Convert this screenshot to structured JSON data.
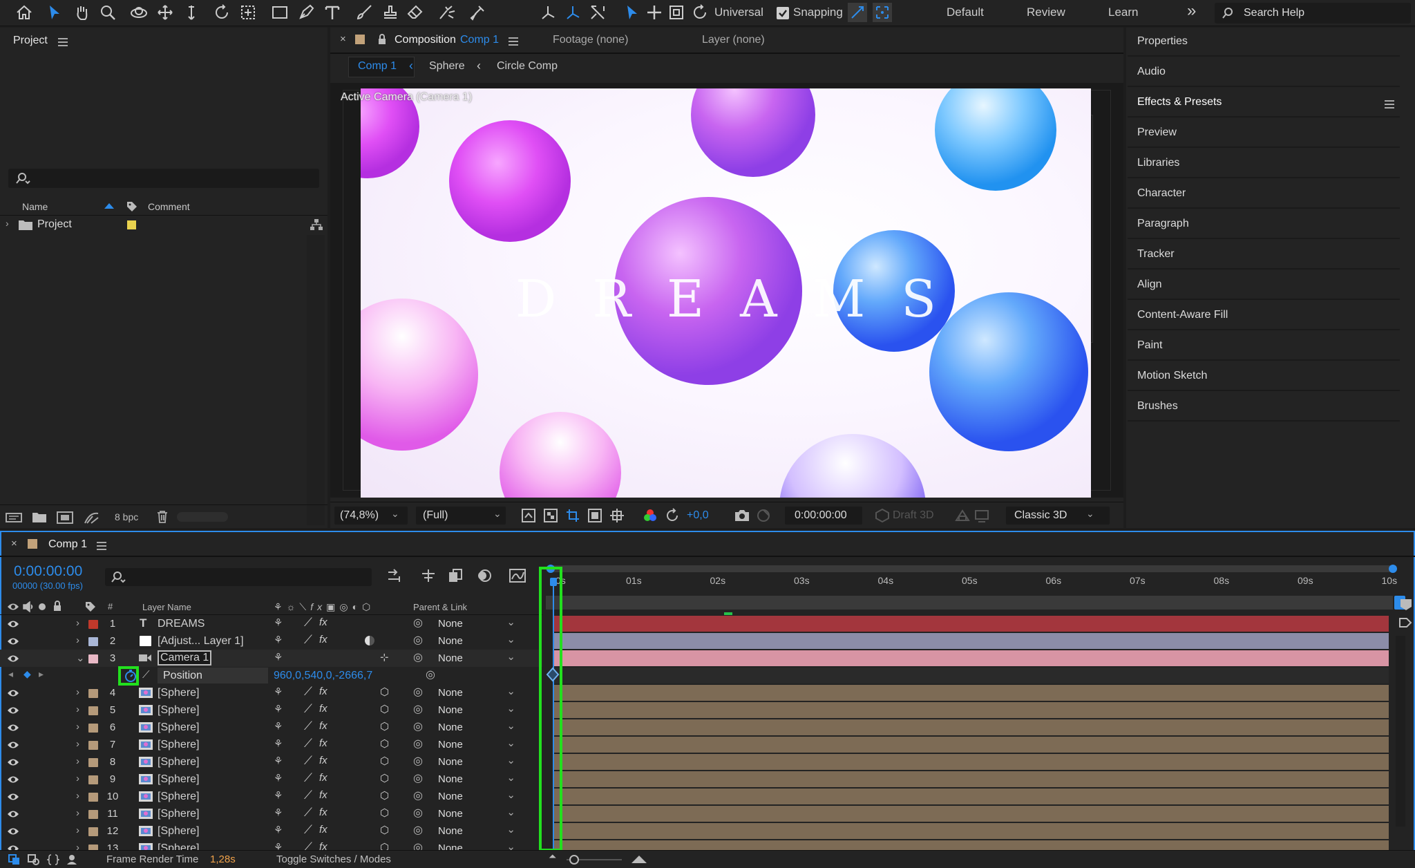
{
  "toolbar": {
    "universal": "Universal",
    "snapping": "Snapping",
    "workspaces": [
      "Default",
      "Review",
      "Learn"
    ],
    "more": "»",
    "search_placeholder": "Search Help"
  },
  "project": {
    "title": "Project",
    "col_name": "Name",
    "col_comment": "Comment",
    "item": "Project",
    "bpc": "8 bpc"
  },
  "comp": {
    "tab_title": "Composition",
    "tab_comp": "Comp 1",
    "footage": "Footage (none)",
    "layer": "Layer (none)",
    "breadcrumbs": [
      "Comp 1",
      "Sphere",
      "Circle Comp"
    ],
    "camera_label": "Active Camera (Camera 1)",
    "canvas_text": "DREAMS",
    "zoom": "(74,8%)",
    "resolution": "(Full)",
    "exposure": "+0,0",
    "timecode": "0:00:00:00",
    "draft": "Draft 3D",
    "renderer": "Classic 3D"
  },
  "right_panel": [
    "Properties",
    "Audio",
    "Effects & Presets",
    "Preview",
    "Libraries",
    "Character",
    "Paragraph",
    "Tracker",
    "Align",
    "Content-Aware Fill",
    "Paint",
    "Motion Sketch",
    "Brushes"
  ],
  "timeline": {
    "tab": "Comp 1",
    "time": "0:00:00:00",
    "frames": "00000 (30.00 fps)",
    "col_layer": "Layer Name",
    "col_hash": "#",
    "col_parent": "Parent & Link",
    "ticks": [
      "01s",
      "02s",
      "03s",
      "04s",
      "05s",
      "06s",
      "07s",
      "08s",
      "09s",
      "10s"
    ],
    "first_tick": "0s",
    "layers": [
      {
        "num": "1",
        "name": "DREAMS",
        "color": "#c0392b",
        "type": "text"
      },
      {
        "num": "2",
        "name": "[Adjust... Layer 1]",
        "color": "#a9b6d6",
        "type": "adjust"
      },
      {
        "num": "3",
        "name": "Camera 1",
        "color": "#e9b9c6",
        "type": "camera"
      },
      {
        "num": "4",
        "name": "[Sphere]",
        "color": "#b59a7a",
        "type": "comp"
      },
      {
        "num": "5",
        "name": "[Sphere]",
        "color": "#b59a7a",
        "type": "comp"
      },
      {
        "num": "6",
        "name": "[Sphere]",
        "color": "#b59a7a",
        "type": "comp"
      },
      {
        "num": "7",
        "name": "[Sphere]",
        "color": "#b59a7a",
        "type": "comp"
      },
      {
        "num": "8",
        "name": "[Sphere]",
        "color": "#b59a7a",
        "type": "comp"
      },
      {
        "num": "9",
        "name": "[Sphere]",
        "color": "#b59a7a",
        "type": "comp"
      },
      {
        "num": "10",
        "name": "[Sphere]",
        "color": "#b59a7a",
        "type": "comp"
      },
      {
        "num": "11",
        "name": "[Sphere]",
        "color": "#b59a7a",
        "type": "comp"
      },
      {
        "num": "12",
        "name": "[Sphere]",
        "color": "#b59a7a",
        "type": "comp"
      },
      {
        "num": "13",
        "name": "[Sphere]",
        "color": "#b59a7a",
        "type": "comp"
      }
    ],
    "parent_none": "None",
    "position_label": "Position",
    "position_value": "960,0,540,0,-2666,7",
    "frame_render_label": "Frame Render Time",
    "frame_render_value": "1,28s",
    "toggle": "Toggle Switches / Modes"
  },
  "colors": {
    "accent": "#2d8ceb",
    "highlight_green": "#22e01e",
    "text_bar": "#a3363d",
    "adjust_bar": "#8c8da8",
    "camera_bar": "#d894a4",
    "comp_bar": "#7d6b55"
  }
}
